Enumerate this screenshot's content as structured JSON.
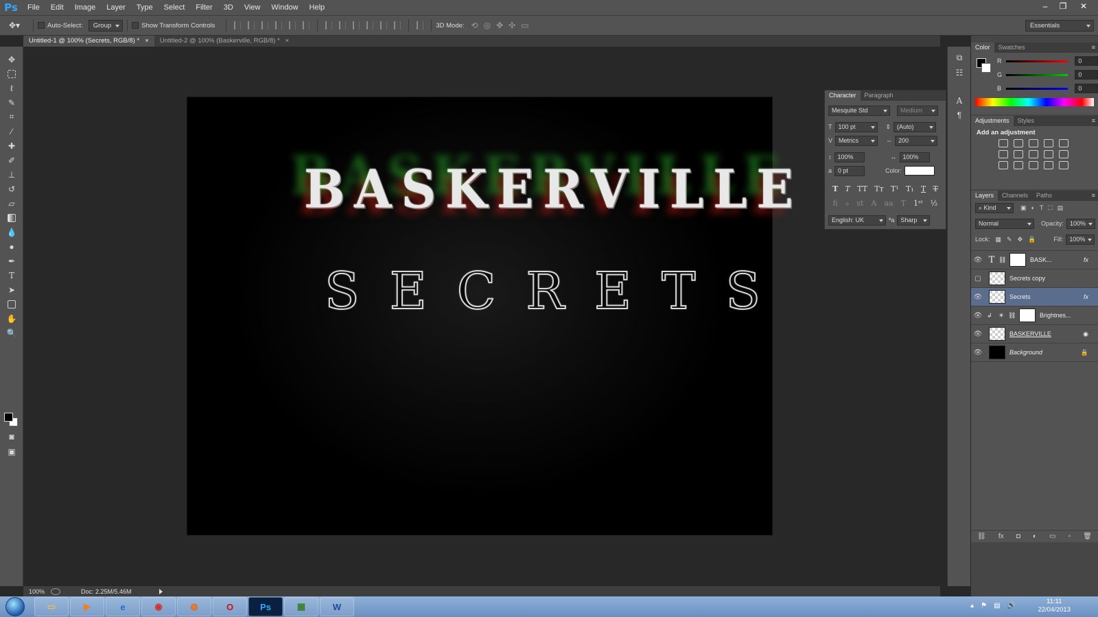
{
  "app": {
    "logo": "Ps"
  },
  "menu": [
    "File",
    "Edit",
    "Image",
    "Layer",
    "Type",
    "Select",
    "Filter",
    "3D",
    "View",
    "Window",
    "Help"
  ],
  "window_controls": {
    "minimize": "–",
    "restore": "❐",
    "close": "✕"
  },
  "options": {
    "auto_select_label": "Auto-Select:",
    "auto_select_value": "Group",
    "show_transform_label": "Show Transform Controls",
    "mode_3d_label": "3D Mode:",
    "workspace": "Essentials"
  },
  "tabs": [
    {
      "label": "Untitled-1 @ 100% (Secrets, RGB/8) *",
      "close": "×"
    },
    {
      "label": "Untitled-2 @ 100% (Baskerville, RGB/8) *",
      "close": "×"
    }
  ],
  "canvas": {
    "title_text": "BASKERVILLE",
    "subtitle_text": "SECRETS"
  },
  "status": {
    "zoom": "100%",
    "doc": "Doc: 2.25M/5.46M"
  },
  "color_panel": {
    "tabs": [
      "Color",
      "Swatches"
    ],
    "channels": [
      {
        "label": "R",
        "value": "0",
        "color": "#ff0000"
      },
      {
        "label": "G",
        "value": "0",
        "color": "#00c000"
      },
      {
        "label": "B",
        "value": "0",
        "color": "#0000ff"
      }
    ]
  },
  "adjustments_panel": {
    "tabs": [
      "Adjustments",
      "Styles"
    ],
    "heading": "Add an adjustment"
  },
  "character_panel": {
    "tabs": [
      "Character",
      "Paragraph"
    ],
    "font_family": "Mesquite Std",
    "font_style": "Medium",
    "size": "100 pt",
    "leading": "(Auto)",
    "kerning": "Metrics",
    "tracking": "200",
    "vscale": "100%",
    "hscale": "100%",
    "baseline": "0 pt",
    "color_label": "Color:",
    "text_color": "#ffffff",
    "language": "English: UK",
    "aa_label": "a",
    "antialias": "Sharp"
  },
  "layers_panel": {
    "tabs": [
      "Layers",
      "Channels",
      "Paths"
    ],
    "kind": "Kind",
    "blend_mode": "Normal",
    "opacity_label": "Opacity:",
    "opacity": "100%",
    "lock_label": "Lock:",
    "fill_label": "Fill:",
    "fill": "100%",
    "layers": [
      {
        "name": "BASK...",
        "visible": true,
        "selected": false
      },
      {
        "name": "Secrets copy",
        "visible": false,
        "selected": false
      },
      {
        "name": "Secrets",
        "visible": true,
        "selected": true
      },
      {
        "name": "Brightnes...",
        "visible": true,
        "selected": false
      },
      {
        "name": "BASKERVILLE",
        "visible": true,
        "selected": false
      },
      {
        "name": "Background",
        "visible": true,
        "selected": false
      }
    ]
  },
  "taskbar": {
    "time": "11:11",
    "date": "22/04/2013"
  }
}
